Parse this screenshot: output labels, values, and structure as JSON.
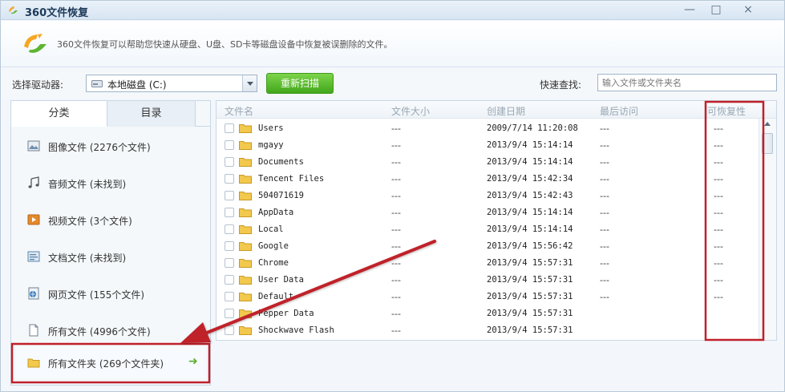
{
  "window": {
    "title": "360文件恢复",
    "min_glyph": "—",
    "max_glyph": "□",
    "close_glyph": "×"
  },
  "banner": {
    "text": "360文件恢复可以帮助您快速从硬盘、U盘、SD卡等磁盘设备中恢复被误删除的文件。"
  },
  "toolbar": {
    "drive_label": "选择驱动器:",
    "drive_value": "本地磁盘 (C:)",
    "scan_label": "重新扫描",
    "quick_label": "快速查找:",
    "quick_placeholder": "输入文件或文件夹名"
  },
  "sidebar": {
    "tabs": [
      {
        "label": "分类"
      },
      {
        "label": "目录"
      }
    ],
    "categories": [
      {
        "label": "图像文件 (2276个文件)",
        "icon": "image-icon"
      },
      {
        "label": "音频文件 (未找到)",
        "icon": "music-icon"
      },
      {
        "label": "视频文件 (3个文件)",
        "icon": "video-icon"
      },
      {
        "label": "文档文件 (未找到)",
        "icon": "document-icon"
      },
      {
        "label": "网页文件 (155个文件)",
        "icon": "webpage-icon"
      },
      {
        "label": "所有文件 (4996个文件)",
        "icon": "file-icon"
      },
      {
        "label": "所有文件夹 (269个文件夹)",
        "icon": "folder-icon"
      }
    ],
    "selected_arrow": "➜"
  },
  "file_list": {
    "headers": {
      "name": "文件名",
      "size": "文件大小",
      "created": "创建日期",
      "accessed": "最后访问",
      "recoverability": "可恢复性"
    },
    "rows": [
      {
        "name": "Users",
        "size": "---",
        "created": "2009/7/14 11:20:08",
        "accessed": "---",
        "recover": "---"
      },
      {
        "name": "mgayy",
        "size": "---",
        "created": "2013/9/4 15:14:14",
        "accessed": "---",
        "recover": "---"
      },
      {
        "name": "Documents",
        "size": "---",
        "created": "2013/9/4 15:14:14",
        "accessed": "---",
        "recover": "---"
      },
      {
        "name": "Tencent Files",
        "size": "---",
        "created": "2013/9/4 15:42:34",
        "accessed": "---",
        "recover": "---"
      },
      {
        "name": "504071619",
        "size": "---",
        "created": "2013/9/4 15:42:43",
        "accessed": "---",
        "recover": "---"
      },
      {
        "name": "AppData",
        "size": "---",
        "created": "2013/9/4 15:14:14",
        "accessed": "---",
        "recover": "---"
      },
      {
        "name": "Local",
        "size": "---",
        "created": "2013/9/4 15:14:14",
        "accessed": "---",
        "recover": "---"
      },
      {
        "name": "Google",
        "size": "---",
        "created": "2013/9/4 15:56:42",
        "accessed": "---",
        "recover": "---"
      },
      {
        "name": "Chrome",
        "size": "---",
        "created": "2013/9/4 15:57:31",
        "accessed": "---",
        "recover": "---"
      },
      {
        "name": "User Data",
        "size": "---",
        "created": "2013/9/4 15:57:31",
        "accessed": "---",
        "recover": "---"
      },
      {
        "name": "Default",
        "size": "---",
        "created": "2013/9/4 15:57:31",
        "accessed": "---",
        "recover": "---"
      },
      {
        "name": "Pepper Data",
        "size": "---",
        "created": "2013/9/4 15:57:31",
        "accessed": "",
        "recover": ""
      },
      {
        "name": "Shockwave Flash",
        "size": "---",
        "created": "2013/9/4 15:57:31",
        "accessed": "",
        "recover": ""
      }
    ]
  },
  "colors": {
    "highlight_red": "#c0202a",
    "scan_green": "#43a71b",
    "folder_yellow": "#f2c94c"
  }
}
